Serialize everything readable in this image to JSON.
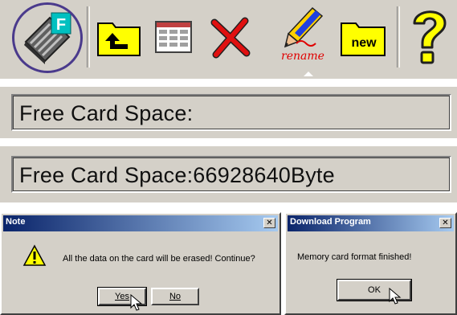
{
  "toolbar": {
    "buttons": [
      {
        "name": "format-card",
        "icon": "memory-card-format-icon",
        "highlighted": true
      },
      {
        "name": "upper-folder",
        "icon": "folder-up-arrow-icon"
      },
      {
        "name": "list-view",
        "icon": "grid-list-icon"
      },
      {
        "name": "delete",
        "icon": "red-x-delete-icon"
      },
      {
        "name": "rename",
        "icon": "pencil-rename-icon",
        "label": "rename"
      },
      {
        "name": "new-folder",
        "icon": "new-folder-icon",
        "label": "new"
      },
      {
        "name": "help",
        "icon": "question-mark-icon"
      }
    ]
  },
  "status": {
    "empty_text": "Free Card Space:",
    "filled_text": "Free Card Space:66928640Byte"
  },
  "note_dialog": {
    "title": "Note",
    "close": "✕",
    "icon": "warning-icon",
    "message": "All the data on the card will be erased! Continue?",
    "yes_label": "Yes",
    "no_label": "No"
  },
  "download_dialog": {
    "title": "Download Program",
    "close": "✕",
    "message": "Memory card format finished!",
    "ok_label": "OK"
  },
  "colors": {
    "titlebar_start": "#0a246a",
    "titlebar_end": "#a6caf0",
    "face": "#d4d0c8",
    "folder_yellow": "#ffff00",
    "format_highlight": "#4a3a8c"
  }
}
